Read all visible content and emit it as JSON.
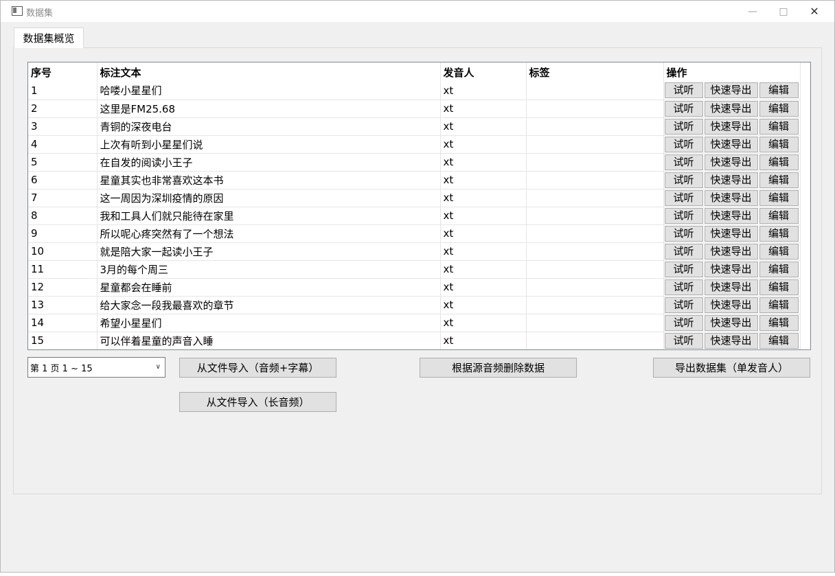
{
  "window": {
    "title": "数据集"
  },
  "tabs": [
    {
      "label": "数据集概览"
    }
  ],
  "table": {
    "headers": [
      "序号",
      "标注文本",
      "发音人",
      "标签",
      "操作"
    ],
    "rows": [
      {
        "index": "1",
        "text": "哈喽小星星们",
        "speaker": "xt",
        "tag": ""
      },
      {
        "index": "2",
        "text": "这里是FM25.68",
        "speaker": "xt",
        "tag": ""
      },
      {
        "index": "3",
        "text": "青铜的深夜电台",
        "speaker": "xt",
        "tag": ""
      },
      {
        "index": "4",
        "text": "上次有听到小星星们说",
        "speaker": "xt",
        "tag": ""
      },
      {
        "index": "5",
        "text": "在自发的阅读小王子",
        "speaker": "xt",
        "tag": ""
      },
      {
        "index": "6",
        "text": "星童其实也非常喜欢这本书",
        "speaker": "xt",
        "tag": ""
      },
      {
        "index": "7",
        "text": "这一周因为深圳疫情的原因",
        "speaker": "xt",
        "tag": ""
      },
      {
        "index": "8",
        "text": "我和工具人们就只能待在家里",
        "speaker": "xt",
        "tag": ""
      },
      {
        "index": "9",
        "text": "所以呢心疼突然有了一个想法",
        "speaker": "xt",
        "tag": ""
      },
      {
        "index": "10",
        "text": "就是陪大家一起读小王子",
        "speaker": "xt",
        "tag": ""
      },
      {
        "index": "11",
        "text": "3月的每个周三",
        "speaker": "xt",
        "tag": ""
      },
      {
        "index": "12",
        "text": "星童都会在睡前",
        "speaker": "xt",
        "tag": ""
      },
      {
        "index": "13",
        "text": "给大家念一段我最喜欢的章节",
        "speaker": "xt",
        "tag": ""
      },
      {
        "index": "14",
        "text": "希望小星星们",
        "speaker": "xt",
        "tag": ""
      },
      {
        "index": "15",
        "text": "可以伴着星童的声音入睡",
        "speaker": "xt",
        "tag": ""
      }
    ],
    "row_actions": {
      "listen": "试听",
      "quick_export": "快速导出",
      "edit": "编辑"
    }
  },
  "pagination": {
    "selected": "第 1 页  1 ~ 15"
  },
  "actions": {
    "import_audio_subtitle": "从文件导入（音频+字幕）",
    "import_long_audio": "从文件导入（长音频）",
    "delete_by_source": "根据源音频删除数据",
    "export_dataset": "导出数据集（单发音人）"
  },
  "icons": {
    "app": "app-window-icon",
    "minimize": "minimize-icon",
    "maximize": "maximize-icon",
    "close": "close-icon",
    "dropdown": "chevron-down-icon"
  },
  "colors": {
    "window_bg": "#f0f0f0",
    "button_bg": "#e1e1e1",
    "button_border": "#adadad",
    "table_border": "#828790"
  }
}
